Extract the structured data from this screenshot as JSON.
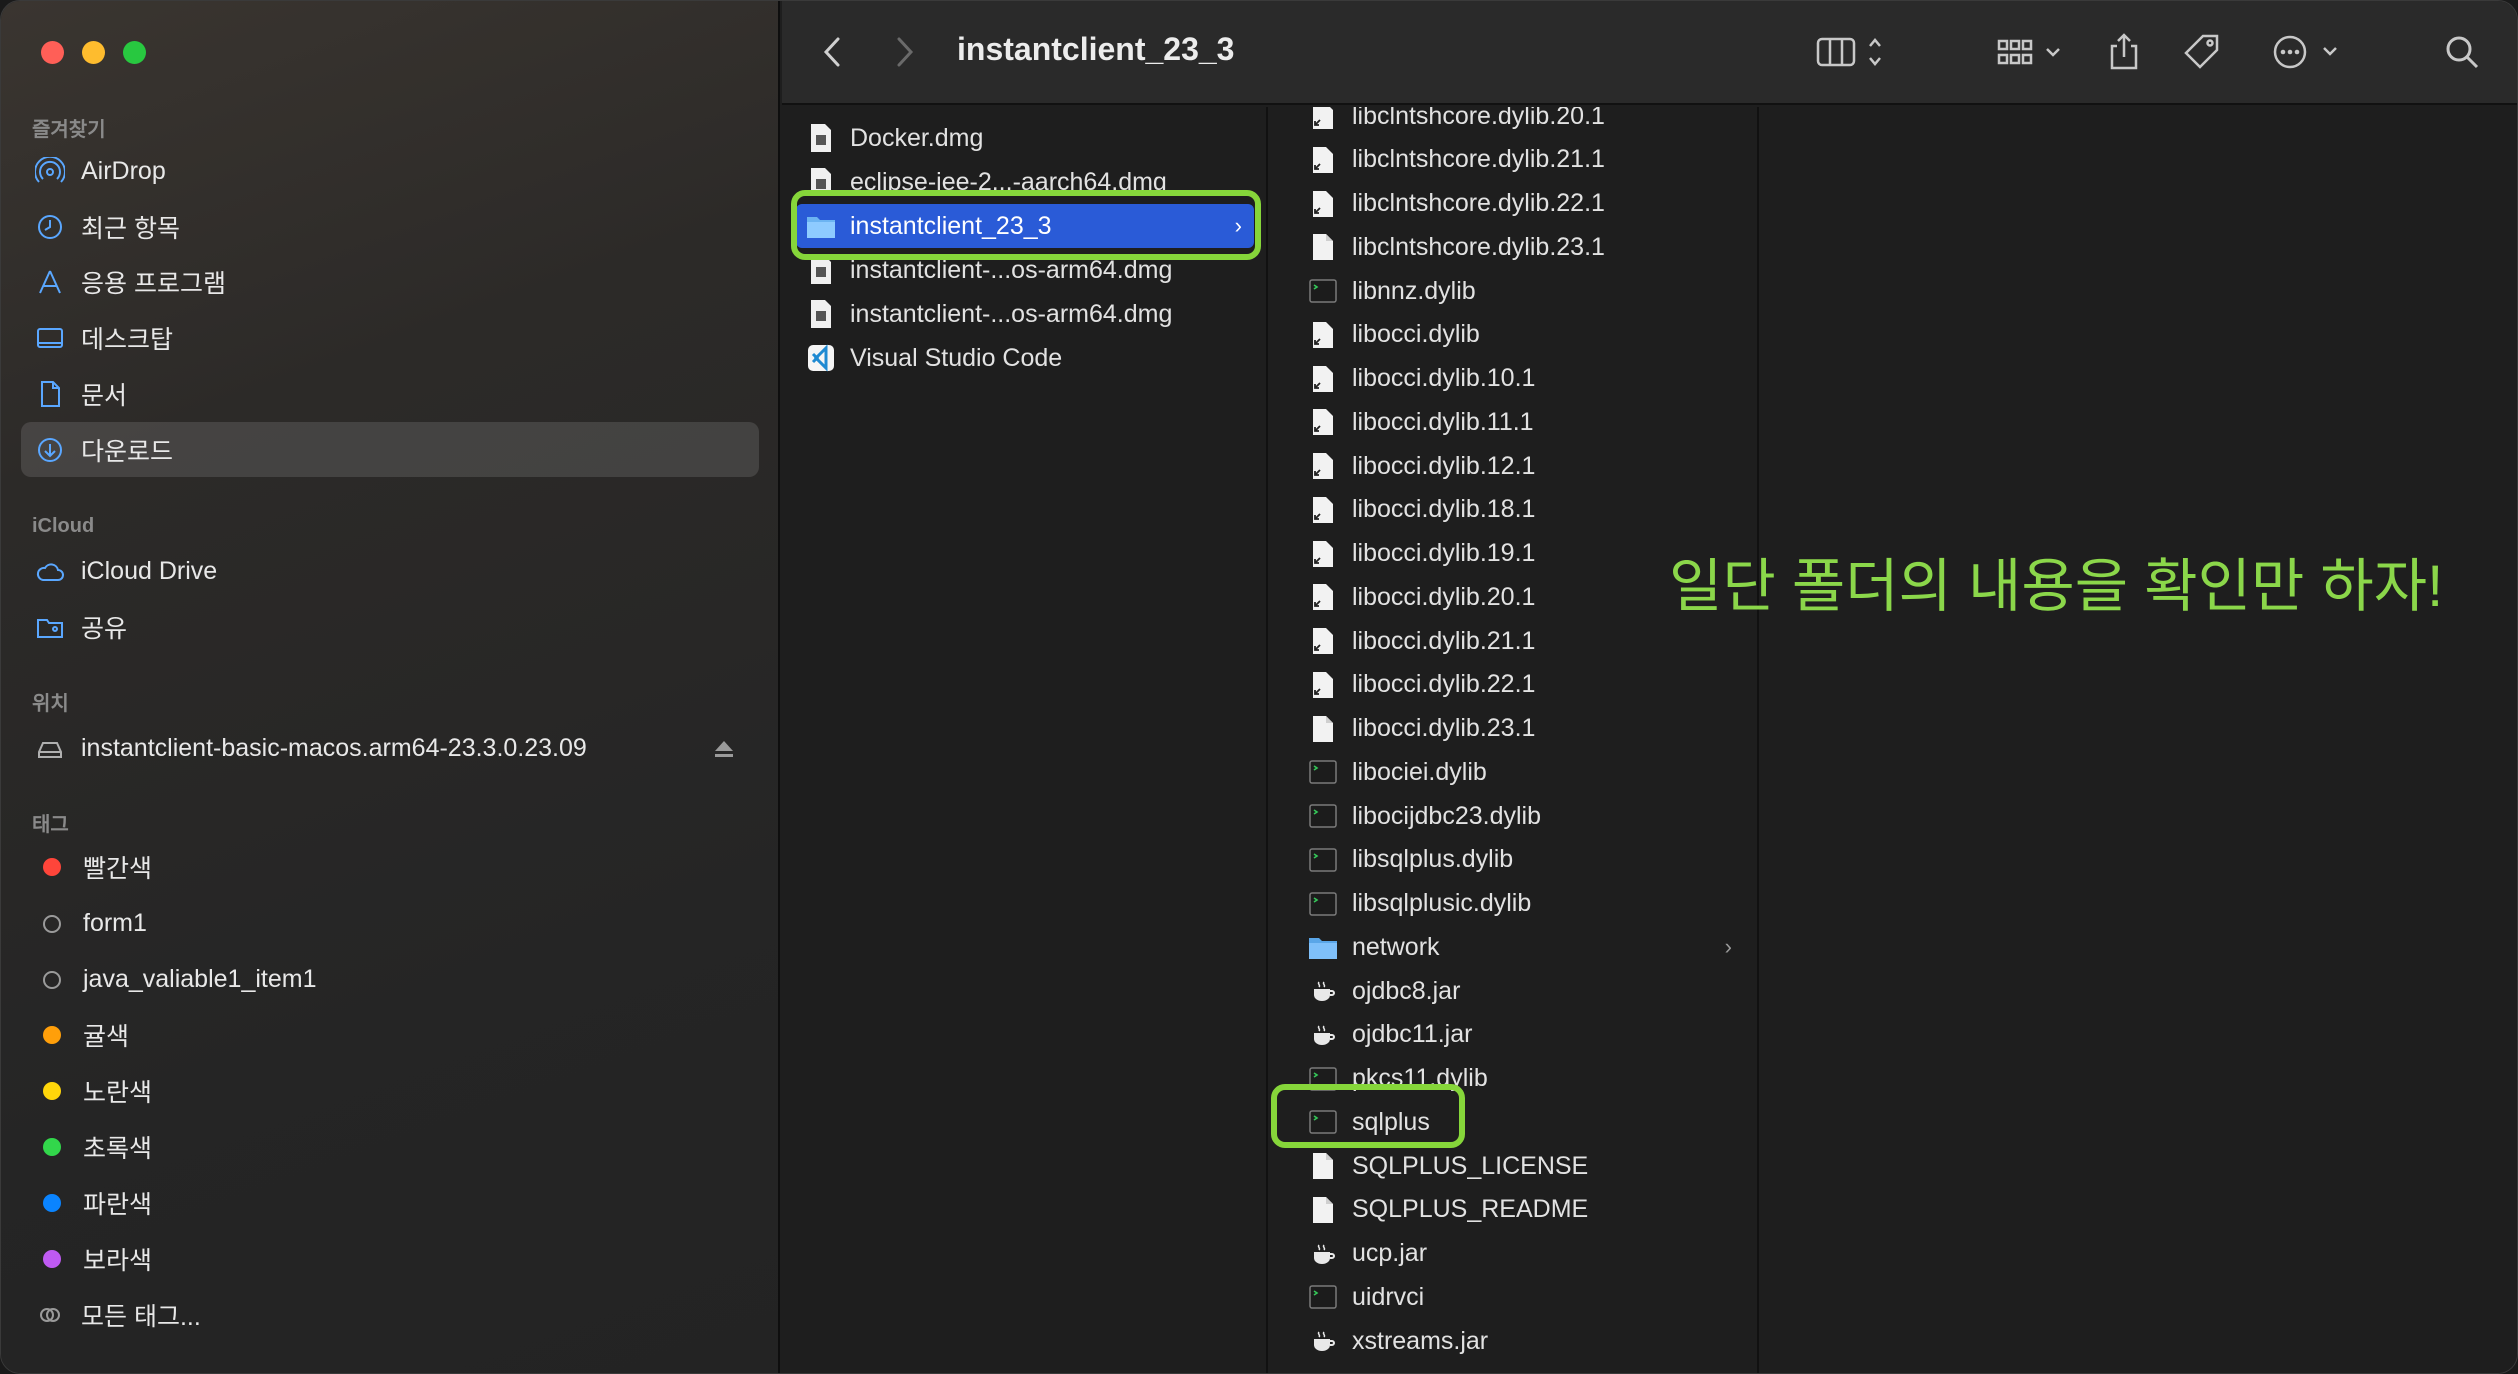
{
  "window": {
    "title": "instantclient_23_3"
  },
  "sidebar": {
    "favorites_header": "즐겨찾기",
    "favorites": [
      {
        "label": "AirDrop",
        "icon": "airdrop-icon"
      },
      {
        "label": "최근 항목",
        "icon": "clock-icon"
      },
      {
        "label": "응용 프로그램",
        "icon": "applications-icon"
      },
      {
        "label": "데스크탑",
        "icon": "desktop-icon"
      },
      {
        "label": "문서",
        "icon": "document-icon"
      },
      {
        "label": "다운로드",
        "icon": "download-icon",
        "active": true
      }
    ],
    "icloud_header": "iCloud",
    "icloud": [
      {
        "label": "iCloud Drive",
        "icon": "cloud-icon"
      },
      {
        "label": "공유",
        "icon": "shared-folder-icon"
      }
    ],
    "locations_header": "위치",
    "locations": [
      {
        "label": "instantclient-basic-macos.arm64-23.3.0.23.09",
        "icon": "drive-icon"
      }
    ],
    "tags_header": "태그",
    "tags": [
      {
        "label": "빨간색",
        "color": "#ff453a"
      },
      {
        "label": "form1",
        "color": ""
      },
      {
        "label": "java_valiable1_item1",
        "color": ""
      },
      {
        "label": "귤색",
        "color": "#ff9f0a"
      },
      {
        "label": "노란색",
        "color": "#ffd60a"
      },
      {
        "label": "초록색",
        "color": "#32d74b"
      },
      {
        "label": "파란색",
        "color": "#0a84ff"
      },
      {
        "label": "보라색",
        "color": "#bf5af2"
      },
      {
        "label": "모든 태그...",
        "color": "all"
      }
    ]
  },
  "column1": [
    {
      "label": "Docker.dmg",
      "icon": "disk-image-icon"
    },
    {
      "label": "eclipse-jee-2...-aarch64.dmg",
      "icon": "disk-image-icon"
    },
    {
      "label": "instantclient_23_3",
      "icon": "folder-icon",
      "selected": true
    },
    {
      "label": "instantclient-...os-arm64.dmg",
      "icon": "disk-image-icon"
    },
    {
      "label": "instantclient-...os-arm64.dmg",
      "icon": "disk-image-icon"
    },
    {
      "label": "Visual Studio Code",
      "icon": "vscode-icon"
    }
  ],
  "column2": [
    {
      "label": "libclntshcore.dylib.20.1",
      "icon": "alias-doc-icon"
    },
    {
      "label": "libclntshcore.dylib.21.1",
      "icon": "alias-doc-icon"
    },
    {
      "label": "libclntshcore.dylib.22.1",
      "icon": "alias-doc-icon"
    },
    {
      "label": "libclntshcore.dylib.23.1",
      "icon": "doc-icon"
    },
    {
      "label": "libnnz.dylib",
      "icon": "exec-icon"
    },
    {
      "label": "libocci.dylib",
      "icon": "alias-doc-icon"
    },
    {
      "label": "libocci.dylib.10.1",
      "icon": "alias-doc-icon"
    },
    {
      "label": "libocci.dylib.11.1",
      "icon": "alias-doc-icon"
    },
    {
      "label": "libocci.dylib.12.1",
      "icon": "alias-doc-icon"
    },
    {
      "label": "libocci.dylib.18.1",
      "icon": "alias-doc-icon"
    },
    {
      "label": "libocci.dylib.19.1",
      "icon": "alias-doc-icon"
    },
    {
      "label": "libocci.dylib.20.1",
      "icon": "alias-doc-icon"
    },
    {
      "label": "libocci.dylib.21.1",
      "icon": "alias-doc-icon"
    },
    {
      "label": "libocci.dylib.22.1",
      "icon": "alias-doc-icon"
    },
    {
      "label": "libocci.dylib.23.1",
      "icon": "doc-icon"
    },
    {
      "label": "libociei.dylib",
      "icon": "exec-icon"
    },
    {
      "label": "libocijdbc23.dylib",
      "icon": "exec-icon"
    },
    {
      "label": "libsqlplus.dylib",
      "icon": "exec-icon"
    },
    {
      "label": "libsqlplusic.dylib",
      "icon": "exec-icon"
    },
    {
      "label": "network",
      "icon": "folder-icon",
      "has_children": true
    },
    {
      "label": "ojdbc8.jar",
      "icon": "jar-icon"
    },
    {
      "label": "ojdbc11.jar",
      "icon": "jar-icon"
    },
    {
      "label": "pkcs11.dylib",
      "icon": "exec-icon"
    },
    {
      "label": "sqlplus",
      "icon": "exec-icon"
    },
    {
      "label": "SQLPLUS_LICENSE",
      "icon": "doc-icon"
    },
    {
      "label": "SQLPLUS_README",
      "icon": "doc-icon"
    },
    {
      "label": "ucp.jar",
      "icon": "jar-icon"
    },
    {
      "label": "uidrvci",
      "icon": "exec-icon"
    },
    {
      "label": "xstreams.jar",
      "icon": "jar-icon"
    }
  ],
  "annotation": "일단 폴더의 내용을 확인만 하자!",
  "colors": {
    "highlight": "#86d63a",
    "selection": "#2a5bd7",
    "annotation": "#8bd74a"
  }
}
